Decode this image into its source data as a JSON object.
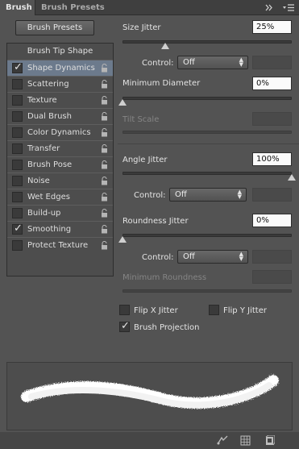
{
  "tabs": [
    {
      "label": "Brush",
      "active": true
    },
    {
      "label": "Brush Presets",
      "active": false
    }
  ],
  "header_icons": [
    "double-chevron-right-icon",
    "panel-menu-icon"
  ],
  "brush_presets_button": "Brush Presets",
  "brush_tip_shape": "Brush Tip Shape",
  "options": [
    {
      "label": "Shape Dynamics",
      "checked": true,
      "selected": true
    },
    {
      "label": "Scattering",
      "checked": false,
      "selected": false
    },
    {
      "label": "Texture",
      "checked": false,
      "selected": false
    },
    {
      "label": "Dual Brush",
      "checked": false,
      "selected": false
    },
    {
      "label": "Color Dynamics",
      "checked": false,
      "selected": false
    },
    {
      "label": "Transfer",
      "checked": false,
      "selected": false
    },
    {
      "label": "Brush Pose",
      "checked": false,
      "selected": false
    },
    {
      "label": "Noise",
      "checked": false,
      "selected": false
    },
    {
      "label": "Wet Edges",
      "checked": false,
      "selected": false
    },
    {
      "label": "Build-up",
      "checked": false,
      "selected": false
    },
    {
      "label": "Smoothing",
      "checked": true,
      "selected": false
    },
    {
      "label": "Protect Texture",
      "checked": false,
      "selected": false
    }
  ],
  "size_jitter": {
    "label": "Size Jitter",
    "value": "25%",
    "fraction": 0.25
  },
  "size_control": {
    "label": "Control:",
    "value": "Off"
  },
  "minimum_diameter": {
    "label": "Minimum Diameter",
    "value": "0%",
    "fraction": 0.0
  },
  "tilt_scale": {
    "label": "Tilt Scale"
  },
  "angle_jitter": {
    "label": "Angle Jitter",
    "value": "100%",
    "fraction": 1.0
  },
  "angle_control": {
    "label": "Control:",
    "value": "Off"
  },
  "roundness_jitter": {
    "label": "Roundness Jitter",
    "value": "0%",
    "fraction": 0.0
  },
  "roundness_control": {
    "label": "Control:",
    "value": "Off"
  },
  "minimum_roundness": {
    "label": "Minimum Roundness"
  },
  "flip_x": {
    "label": "Flip X Jitter",
    "checked": false
  },
  "flip_y": {
    "label": "Flip Y Jitter",
    "checked": false
  },
  "brush_projection": {
    "label": "Brush Projection",
    "checked": true
  },
  "footer_icons": [
    "toggle-live-tip-icon",
    "brush-editor-grid-icon",
    "new-brush-icon"
  ],
  "colors": {
    "panel_bg": "#535353",
    "selected_row": "#6c7a8c",
    "stroke": "#ffffff"
  }
}
